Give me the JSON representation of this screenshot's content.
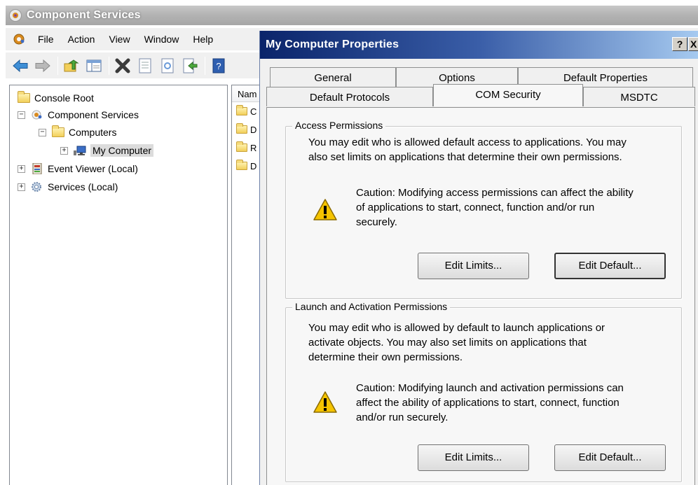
{
  "mmc": {
    "title": "Component Services",
    "menu": [
      "File",
      "Action",
      "View",
      "Window",
      "Help"
    ],
    "toolbar_icons": [
      "back-arrow-icon",
      "forward-arrow-icon",
      "up-folder-icon",
      "show-hide-tree-icon",
      "delete-icon",
      "properties-icon",
      "refresh-icon",
      "export-list-icon",
      "help-icon"
    ],
    "tree": [
      {
        "label": "Console Root",
        "expander": ""
      },
      {
        "label": "Component Services",
        "expander": "−"
      },
      {
        "label": "Computers",
        "expander": "−"
      },
      {
        "label": "My Computer",
        "expander": "+"
      },
      {
        "label": "Event Viewer (Local)",
        "expander": "+"
      },
      {
        "label": "Services (Local)",
        "expander": "+"
      }
    ],
    "list_header": "Nam",
    "list_items": [
      "C",
      "D",
      "R",
      "D"
    ]
  },
  "dialog": {
    "title": "My Computer Properties",
    "help_button": "?",
    "close_button": "X",
    "tabs_row1": [
      "General",
      "Options",
      "Default Properties"
    ],
    "tabs_row2": [
      "Default Protocols",
      "COM Security",
      "MSDTC"
    ],
    "active_tab": "COM Security",
    "access": {
      "legend": "Access Permissions",
      "desc_lines": [
        "You may edit who is allowed default access to applications. You may",
        "also set limits on applications that determine their own permissions."
      ],
      "caution_lines": [
        "Caution: Modifying access permissions can affect the ability",
        "of applications to start, connect, function and/or run",
        "securely."
      ],
      "edit_limits": "Edit Limits...",
      "edit_default": "Edit Default..."
    },
    "launch": {
      "legend": "Launch and Activation Permissions",
      "desc_lines": [
        "You may edit who is allowed by default to launch applications or",
        "activate objects. You may also set limits on applications that",
        "determine their own permissions."
      ],
      "caution_lines": [
        "Caution: Modifying launch and activation permissions can",
        "affect the ability of applications to start, connect, function",
        "and/or run securely."
      ],
      "edit_limits": "Edit Limits...",
      "edit_default": "Edit Default..."
    }
  },
  "colors": {
    "dialog_title_start": "#0a246a",
    "dialog_title_end": "#a6caf0",
    "warning_yellow": "#f5c400"
  }
}
